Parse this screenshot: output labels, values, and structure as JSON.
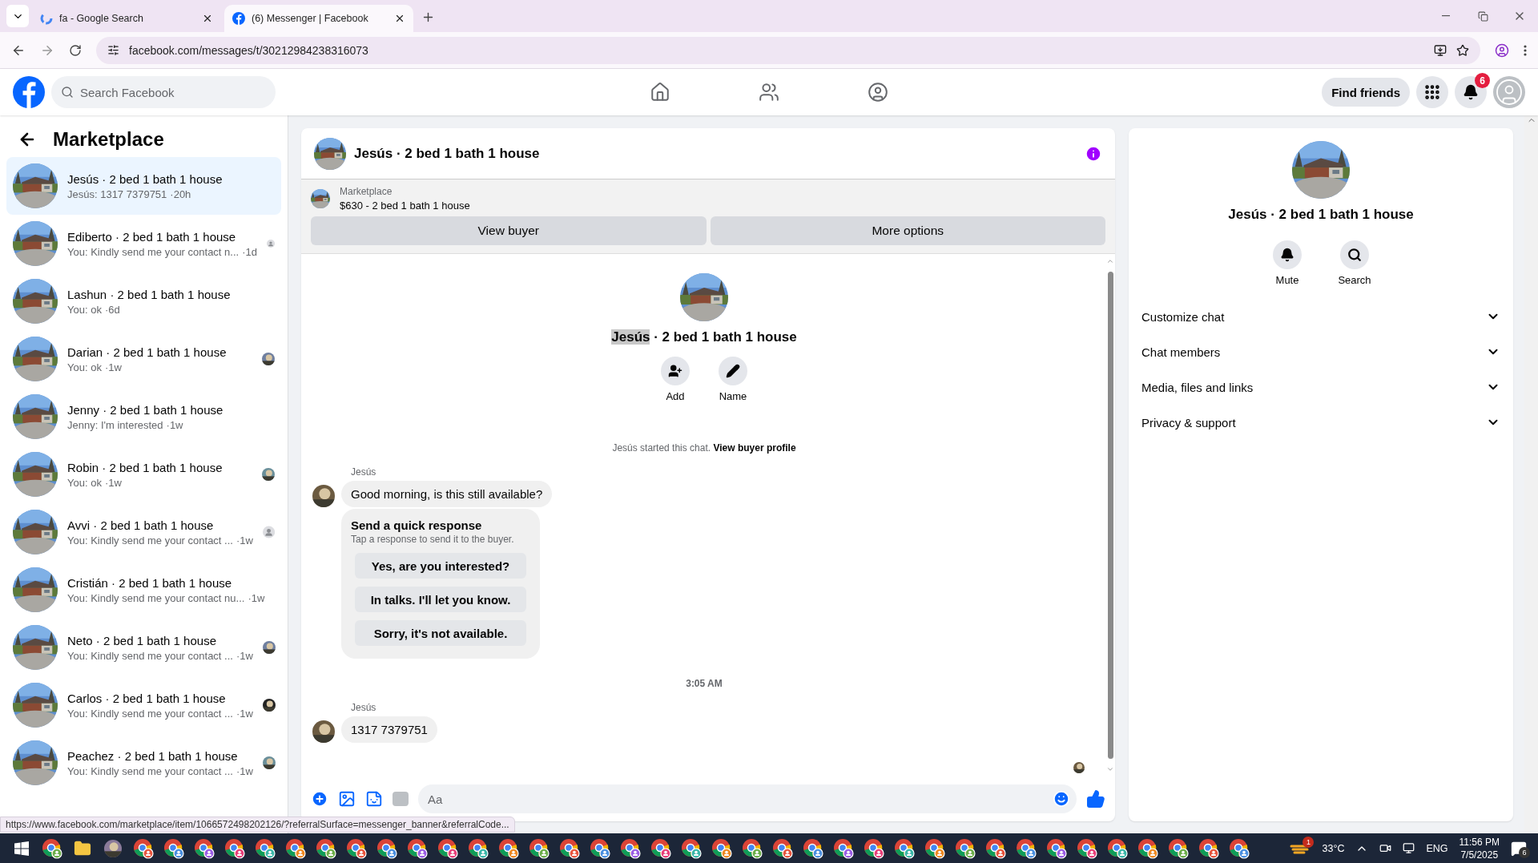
{
  "browser": {
    "tabs": [
      {
        "title": "fa - Google Search",
        "selected": false,
        "kind": "google"
      },
      {
        "title": "(6) Messenger | Facebook",
        "selected": true,
        "kind": "facebook"
      }
    ],
    "url": "facebook.com/messages/t/30212984238316073",
    "status_url": "https://www.facebook.com/marketplace/item/1066572498202126/?referralSurface=messenger_banner&referralCode..."
  },
  "header": {
    "search_placeholder": "Search Facebook",
    "find_friends": "Find friends",
    "notification_count": "6"
  },
  "sidebar": {
    "title": "Marketplace",
    "conversations": [
      {
        "title": "Jesús · 2 bed 1 bath 1 house",
        "preview": "Jesús: 1317 7379751",
        "time": "·20h",
        "selected": true,
        "kind": "none"
      },
      {
        "title": "Ediberto · 2 bed 1 bath 1 house",
        "preview": "You: Kindly send me your contact n...",
        "time": "·1d",
        "selected": false,
        "kind": "generic"
      },
      {
        "title": "Lashun · 2 bed 1 bath 1 house",
        "preview": "You: ok",
        "time": "·6d",
        "selected": false,
        "kind": "none"
      },
      {
        "title": "Darian · 2 bed 1 bath 1 house",
        "preview": "You: ok",
        "time": "·1w",
        "selected": false
      },
      {
        "title": "Jenny · 2 bed 1 bath 1 house",
        "preview": "Jenny: I'm interested",
        "time": "·1w",
        "selected": false,
        "kind": "none"
      },
      {
        "title": "Robin · 2 bed 1 bath 1 house",
        "preview": "You: ok",
        "time": "·1w",
        "selected": false
      },
      {
        "title": "Avvi · 2 bed 1 bath 1 house",
        "preview": "You: Kindly send me your contact ...",
        "time": "·1w",
        "selected": false,
        "kind": "generic"
      },
      {
        "title": "Cristián · 2 bed 1 bath 1 house",
        "preview": "You: Kindly send me your contact nu...",
        "time": "·1w",
        "selected": false,
        "kind": "none"
      },
      {
        "title": "Neto · 2 bed 1 bath 1 house",
        "preview": "You: Kindly send me your contact ...",
        "time": "·1w",
        "selected": false
      },
      {
        "title": "Carlos · 2 bed 1 bath 1 house",
        "preview": "You: Kindly send me your contact ...",
        "time": "·1w",
        "selected": false
      },
      {
        "title": "Peachez · 2 bed 1 bath 1 house",
        "preview": "You: Kindly send me your contact ...",
        "time": "·1w",
        "selected": false
      }
    ]
  },
  "chat": {
    "title": "Jesús · 2 bed 1 bath 1 house",
    "listing": {
      "label": "Marketplace",
      "name": "$630 - 2 bed 1 bath 1 house"
    },
    "buttons": [
      "View buyer",
      "More options"
    ],
    "intro": {
      "title_parts": [
        {
          "text": "Jesús",
          "highlighted": true
        },
        {
          "text": " · 2 bed 1 bath 1 house",
          "highlighted": false
        }
      ],
      "actions": [
        {
          "label": "Add",
          "kind": "add"
        },
        {
          "label": "Name",
          "kind": "name"
        }
      ],
      "started": "Jesús started this chat.",
      "profile_link": "View buyer profile"
    },
    "messages": [
      {
        "kind": "text",
        "sender": "Jesús",
        "text": "Good morning, is this still available?"
      },
      {
        "kind": "quick",
        "title": "Send a quick response",
        "subtitle": "Tap a response to send it to the buyer.",
        "options": [
          "Yes, are you interested?",
          "In talks. I'll let you know.",
          "Sorry, it's not available."
        ]
      },
      {
        "kind": "time",
        "text": "3:05 AM"
      },
      {
        "kind": "text",
        "sender": "Jesús",
        "text": "1317 7379751"
      }
    ],
    "composer_placeholder": "Aa"
  },
  "details": {
    "title": "Jesús · 2 bed 1 bath 1 house",
    "actions": [
      {
        "label": "Mute",
        "kind": "bell"
      },
      {
        "label": "Search",
        "kind": "search"
      }
    ],
    "sections": [
      {
        "label": "Customize chat",
        "expanded": false
      },
      {
        "label": "Chat members",
        "expanded": false
      },
      {
        "label": "Media, files and links",
        "expanded": false
      },
      {
        "label": "Privacy & support",
        "expanded": false
      }
    ]
  },
  "taskbar": {
    "weather_badge": "1",
    "temperature": "33°C",
    "language": "ENG",
    "time": "11:56 PM",
    "date": "7/5/2025",
    "notification_count": "6"
  }
}
